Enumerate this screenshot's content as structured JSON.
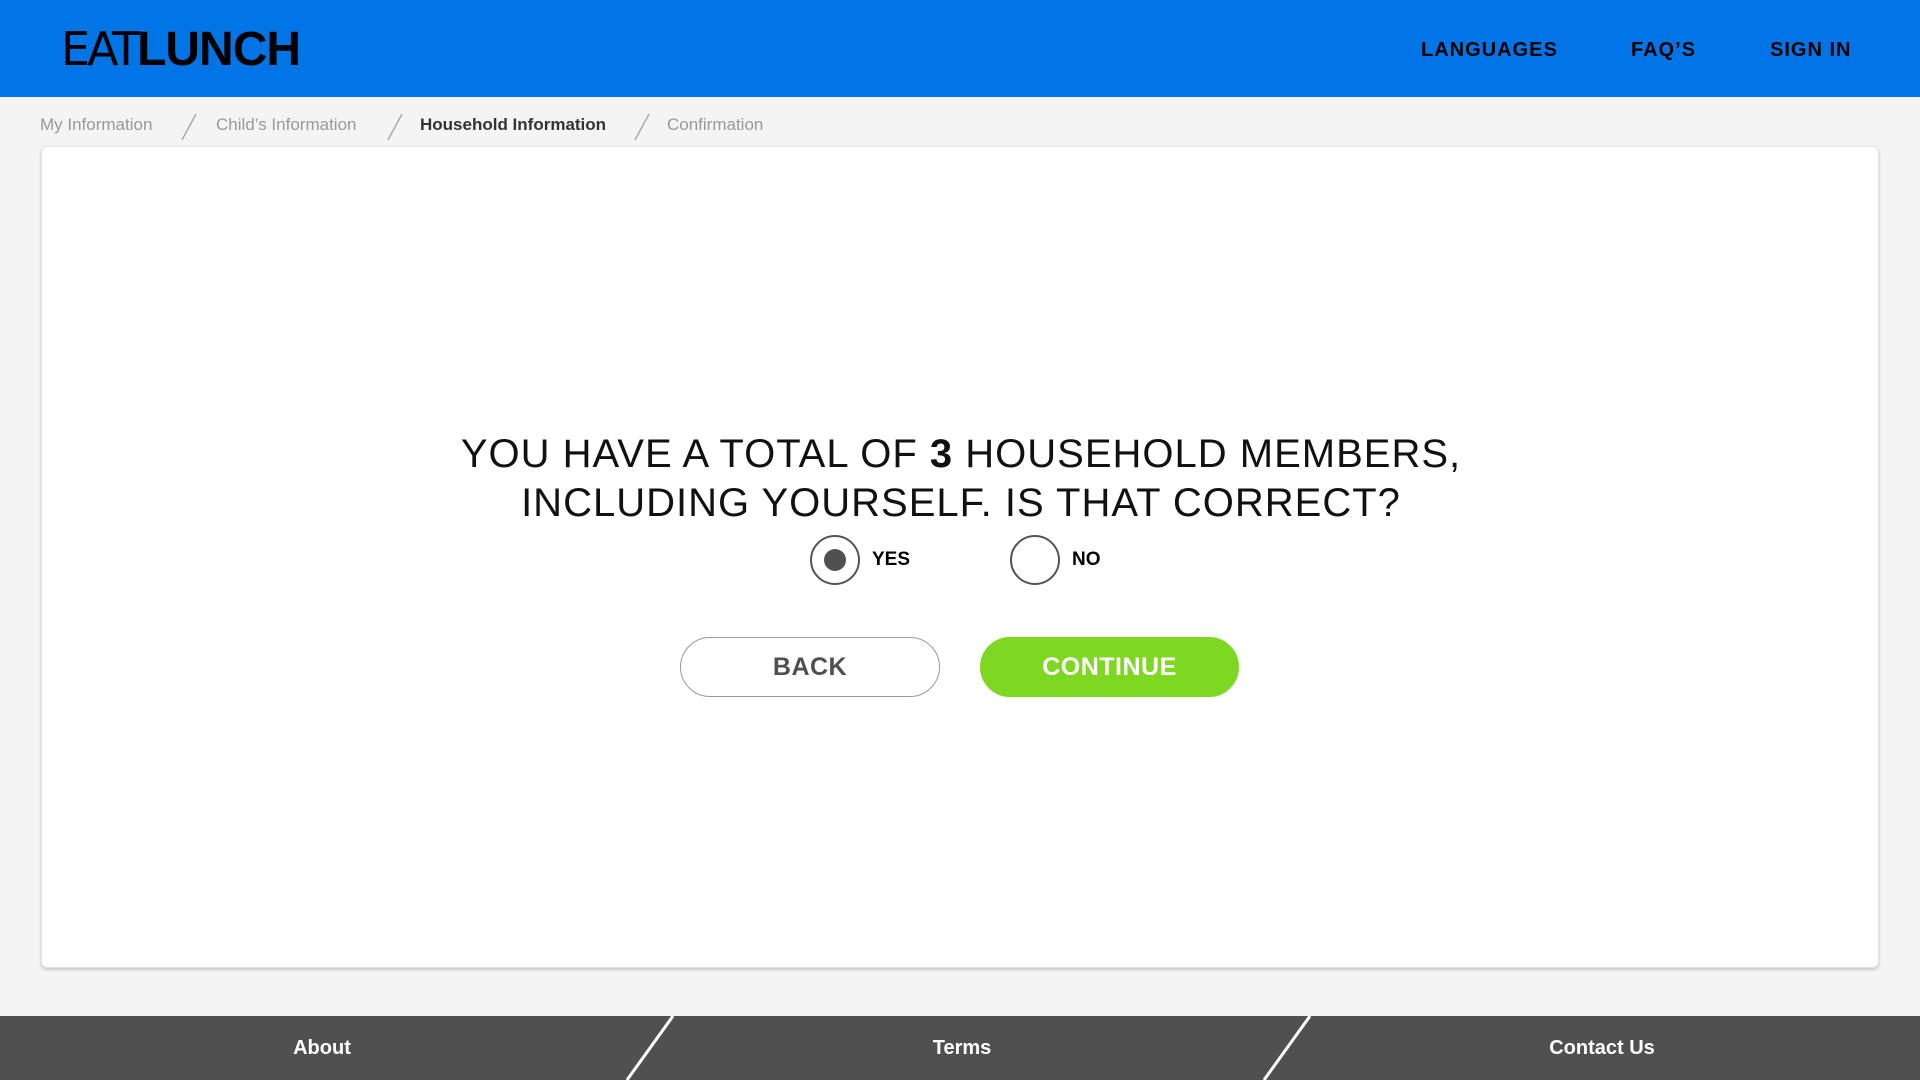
{
  "header": {
    "logo": {
      "light": "EAT",
      "bold": "LUNCH"
    },
    "nav": [
      {
        "label": "LANGUAGES"
      },
      {
        "label": "FAQ’S"
      },
      {
        "label": "SIGN IN"
      }
    ],
    "background_color": "#0275e6"
  },
  "breadcrumb": [
    {
      "label": "My Information",
      "active": false
    },
    {
      "label": "Child’s Information",
      "active": false
    },
    {
      "label": "Household Information",
      "active": true
    },
    {
      "label": "Confirmation",
      "active": false
    }
  ],
  "main": {
    "question": {
      "prefix": "YOU HAVE A TOTAL OF ",
      "count": "3",
      "suffix": " HOUSEHOLD MEMBERS,",
      "line2": "INCLUDING YOURSELF. IS THAT CORRECT?"
    },
    "options": [
      {
        "label": "YES",
        "selected": true
      },
      {
        "label": "NO",
        "selected": false
      }
    ],
    "back_label": "BACK",
    "continue_label": "CONTINUE",
    "continue_color": "#7ed821"
  },
  "footer": {
    "links": [
      {
        "label": "About"
      },
      {
        "label": "Terms"
      },
      {
        "label": "Contact Us"
      }
    ],
    "background_color": "#505050"
  }
}
